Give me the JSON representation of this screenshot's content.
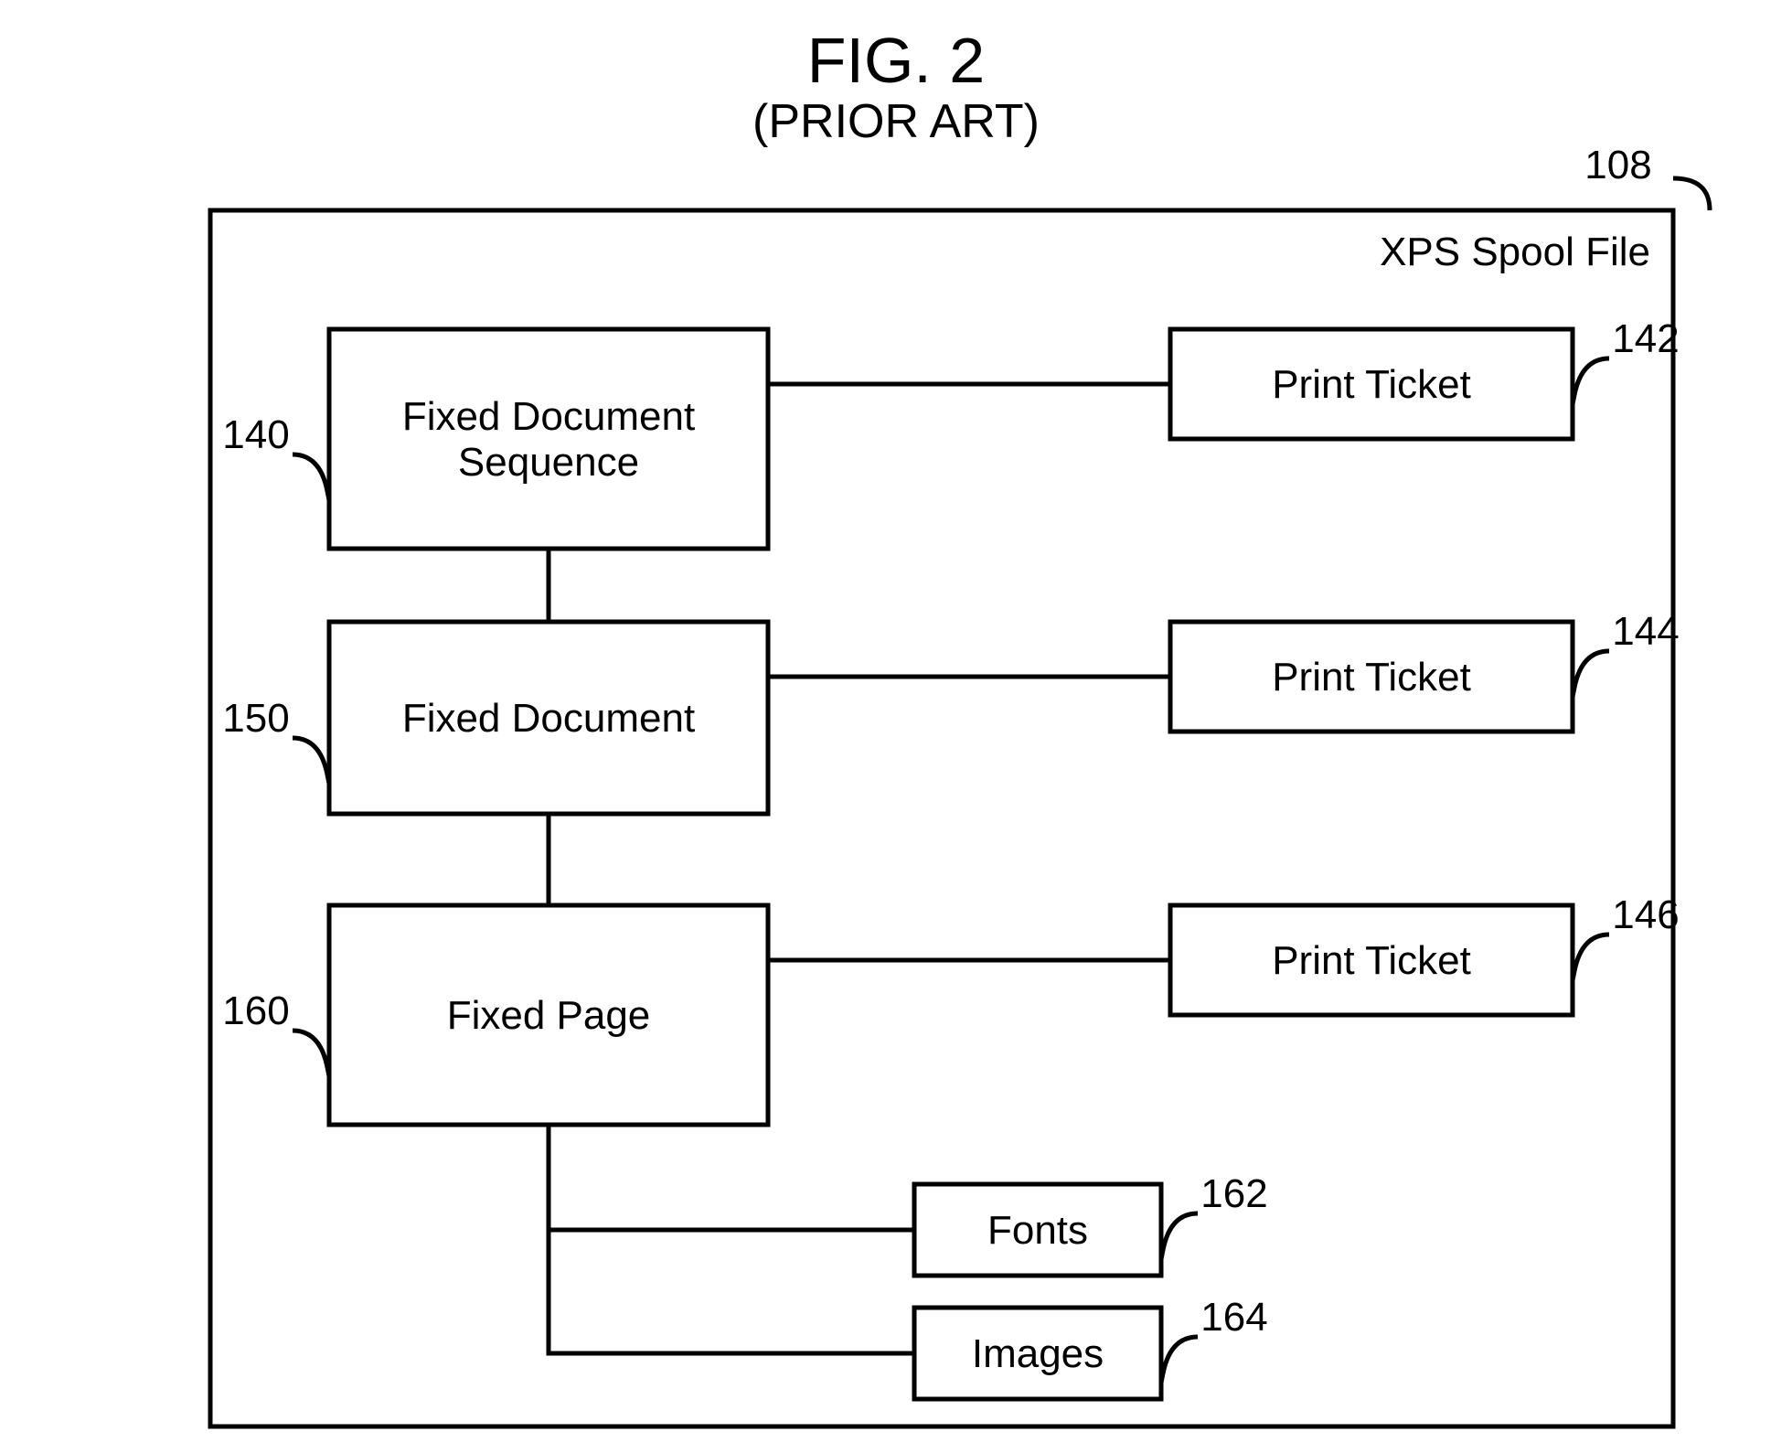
{
  "figure": {
    "title_line1": "FIG. 2",
    "title_line2": "(PRIOR ART)"
  },
  "container": {
    "label": "XPS Spool File",
    "ref": "108"
  },
  "boxes": {
    "fixed_document_sequence": {
      "line1": "Fixed Document",
      "line2": "Sequence",
      "ref": "140"
    },
    "fixed_document": {
      "label": "Fixed Document",
      "ref": "150"
    },
    "fixed_page": {
      "label": "Fixed Page",
      "ref": "160"
    },
    "print_ticket_1": {
      "label": "Print Ticket",
      "ref": "142"
    },
    "print_ticket_2": {
      "label": "Print Ticket",
      "ref": "144"
    },
    "print_ticket_3": {
      "label": "Print Ticket",
      "ref": "146"
    },
    "fonts": {
      "label": "Fonts",
      "ref": "162"
    },
    "images": {
      "label": "Images",
      "ref": "164"
    }
  }
}
